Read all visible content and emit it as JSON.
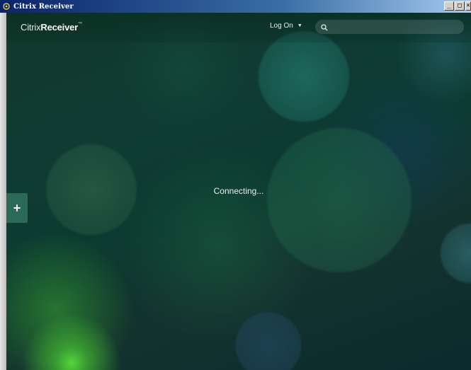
{
  "window": {
    "title": "Citrix Receiver",
    "controls": {
      "minimize": "_",
      "maximize": "□",
      "close": "×"
    }
  },
  "header": {
    "brand_prefix": "Citrix",
    "brand_name": "Receiver",
    "brand_mark": "™",
    "logon_label": "Log On",
    "logon_icon": "chevron-down-icon",
    "search_icon": "search-icon",
    "search_placeholder": ""
  },
  "main": {
    "status_text": "Connecting..."
  },
  "sidebar": {
    "add_symbol": "+"
  },
  "colors": {
    "titlebar": "#0a246a",
    "add_tab": "#2c6a58",
    "text_light": "#e9f0ec"
  }
}
